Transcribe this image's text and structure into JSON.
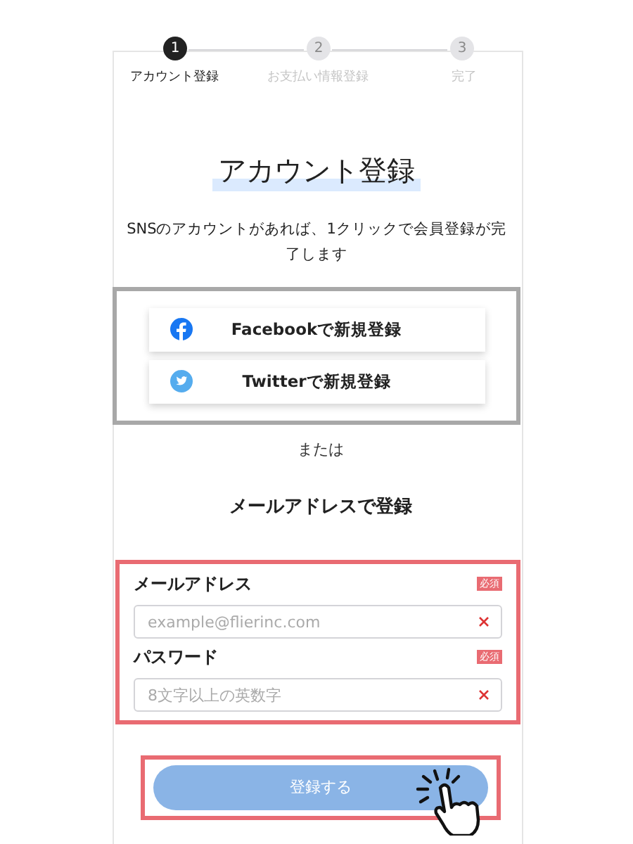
{
  "steps": [
    {
      "number": "1",
      "label": "アカウント登録",
      "current": true
    },
    {
      "number": "2",
      "label": "お支払い情報登録",
      "current": false
    },
    {
      "number": "3",
      "label": "完了",
      "current": false
    }
  ],
  "title": "アカウント登録",
  "description": "SNSのアカウントがあれば、1クリックで会員登録が完了します",
  "sns_buttons": [
    {
      "kind": "facebook",
      "label": "Facebookで新規登録"
    },
    {
      "kind": "twitter",
      "label": "Twitterで新規登録"
    }
  ],
  "separator": "または",
  "email_heading": "メールアドレスで登録",
  "fields": [
    {
      "label": "メールアドレス",
      "required_badge": "必須",
      "placeholder": "example@flierinc.com"
    },
    {
      "label": "パスワード",
      "required_badge": "必須",
      "placeholder": "8文字以上の英数字"
    }
  ],
  "submit_button": {
    "label": "登録する",
    "disabled": true
  }
}
